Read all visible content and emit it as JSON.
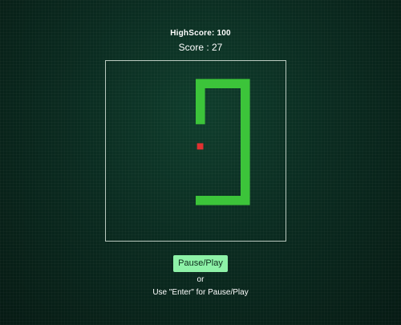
{
  "header": {
    "highscore_label": "HighScore: 100",
    "score_label": "Score : 27"
  },
  "game": {
    "board_grid": {
      "cols": 20,
      "rows": 20
    },
    "snake": {
      "color": "#3cc43a",
      "segments_cells": [
        [
          10,
          15
        ],
        [
          11,
          15
        ],
        [
          12,
          15
        ],
        [
          13,
          15
        ],
        [
          14,
          15
        ],
        [
          15,
          15
        ],
        [
          15,
          14
        ],
        [
          15,
          13
        ],
        [
          15,
          12
        ],
        [
          15,
          11
        ],
        [
          15,
          10
        ],
        [
          15,
          9
        ],
        [
          15,
          8
        ],
        [
          15,
          7
        ],
        [
          15,
          6
        ],
        [
          15,
          5
        ],
        [
          15,
          4
        ],
        [
          15,
          3
        ],
        [
          15,
          2
        ],
        [
          14,
          2
        ],
        [
          13,
          2
        ],
        [
          12,
          2
        ],
        [
          11,
          2
        ],
        [
          10,
          2
        ],
        [
          10,
          3
        ],
        [
          10,
          4
        ],
        [
          10,
          5
        ],
        [
          10,
          6
        ]
      ]
    },
    "food": {
      "color": "#e03131",
      "cell": [
        10,
        9
      ]
    },
    "board_border_color": "#b9c9bf"
  },
  "controls": {
    "pause_button_label": "Pause/Play",
    "or_label": "or",
    "hint_label": "Use \"Enter\" for Pause/Play"
  }
}
